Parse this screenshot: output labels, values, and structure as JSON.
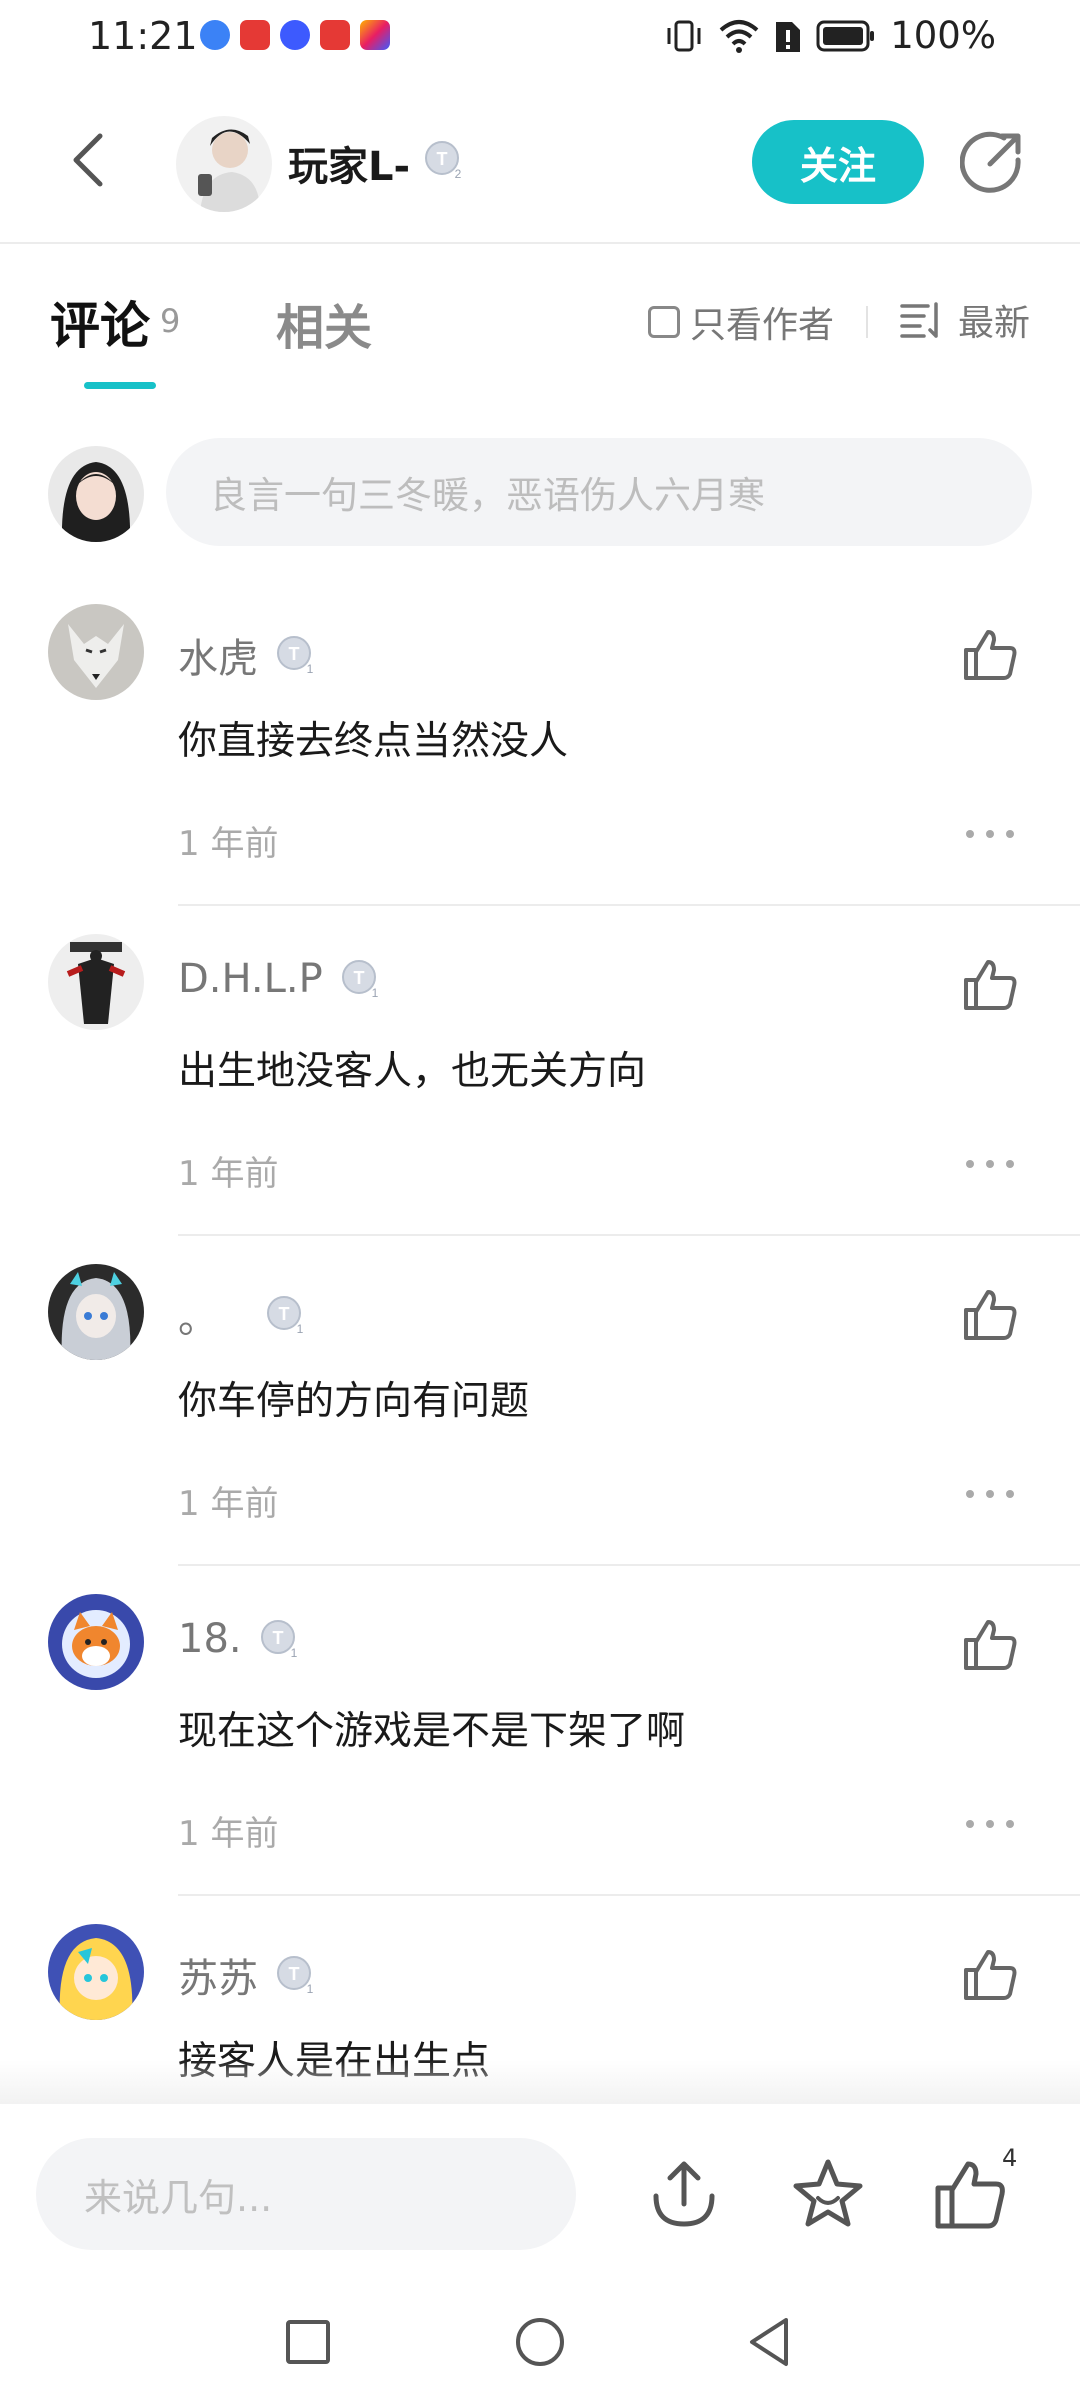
{
  "status_bar": {
    "time": "11:21",
    "battery": "100%",
    "app_icons": [
      {
        "name": "blue-app-icon",
        "color": "#3b82f6"
      },
      {
        "name": "red-book-app-icon",
        "color": "#e53935"
      },
      {
        "name": "music-app-icon",
        "color": "#3d5afe"
      },
      {
        "name": "huawei-app-icon",
        "color": "#e53935"
      },
      {
        "name": "colorful-app-icon",
        "color": "#ffb300"
      }
    ]
  },
  "header": {
    "author_name": "玩家L-",
    "author_level": "2",
    "follow_label": "关注"
  },
  "tabs": {
    "comments_label": "评论",
    "comments_count": "9",
    "related_label": "相关",
    "author_only_label": "只看作者",
    "sort_label": "最新"
  },
  "composer": {
    "placeholder": "良言一句三冬暖，恶语伤人六月寒"
  },
  "comments": [
    {
      "name": "水虎",
      "level": "1",
      "text": "你直接去终点当然没人",
      "time": "1 年前"
    },
    {
      "name": "D.H.L.P",
      "level": "1",
      "text": "出生地没客人，也无关方向",
      "time": "1 年前"
    },
    {
      "name": "。",
      "level": "1",
      "text": "你车停的方向有问题",
      "time": "1 年前"
    },
    {
      "name": "18.",
      "level": "1",
      "text": "现在这个游戏是不是下架了啊",
      "time": "1 年前"
    },
    {
      "name": "苏苏",
      "level": "1",
      "text": "接客人是在出生点",
      "time": ""
    }
  ],
  "bottom_bar": {
    "input_placeholder": "来说几句...",
    "like_count": "4"
  },
  "colors": {
    "accent": "#17c1c8"
  }
}
